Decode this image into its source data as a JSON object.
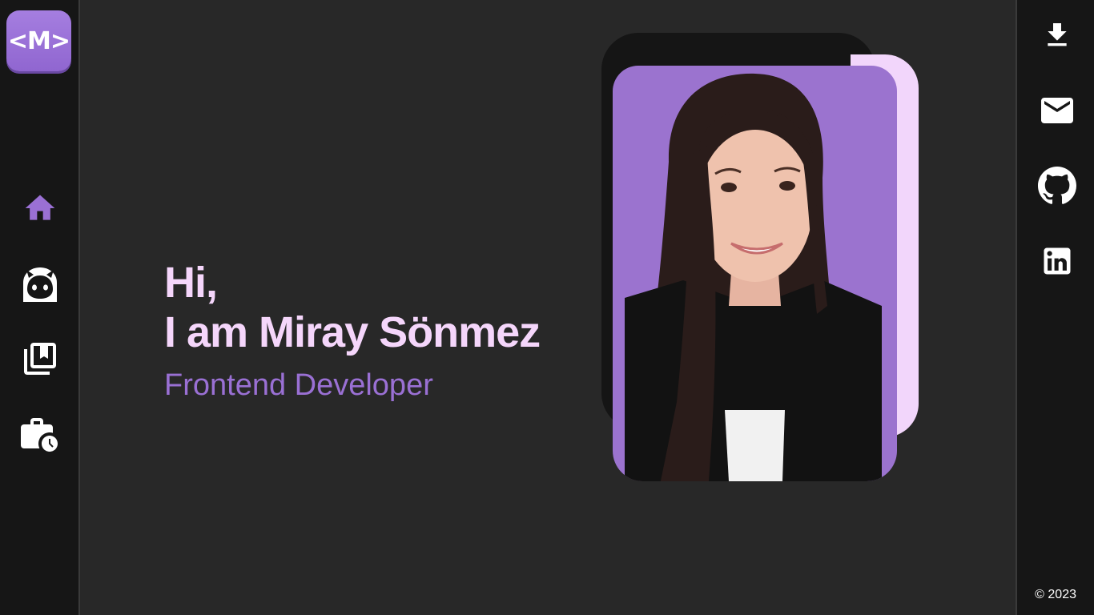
{
  "logo": {
    "text": "<M>"
  },
  "nav": [
    {
      "name": "home",
      "icon": "home-icon",
      "active": true
    },
    {
      "name": "about",
      "icon": "cat-face-icon",
      "active": false
    },
    {
      "name": "portfolio",
      "icon": "bookmarks-icon",
      "active": false
    },
    {
      "name": "experience",
      "icon": "work-history-icon",
      "active": false
    }
  ],
  "hero": {
    "greeting": "Hi,",
    "name": "I am Miray Sönmez",
    "role": "Frontend Developer"
  },
  "social": [
    {
      "name": "download-cv",
      "icon": "download-icon"
    },
    {
      "name": "email",
      "icon": "mail-icon"
    },
    {
      "name": "github",
      "icon": "github-icon"
    },
    {
      "name": "linkedin",
      "icon": "linkedin-icon"
    }
  ],
  "footer": {
    "copyright": "© 2023"
  },
  "colors": {
    "background": "#282828",
    "sidebar": "#161616",
    "accent_purple": "#9a70d4",
    "accent_pink": "#f5d6fb"
  }
}
